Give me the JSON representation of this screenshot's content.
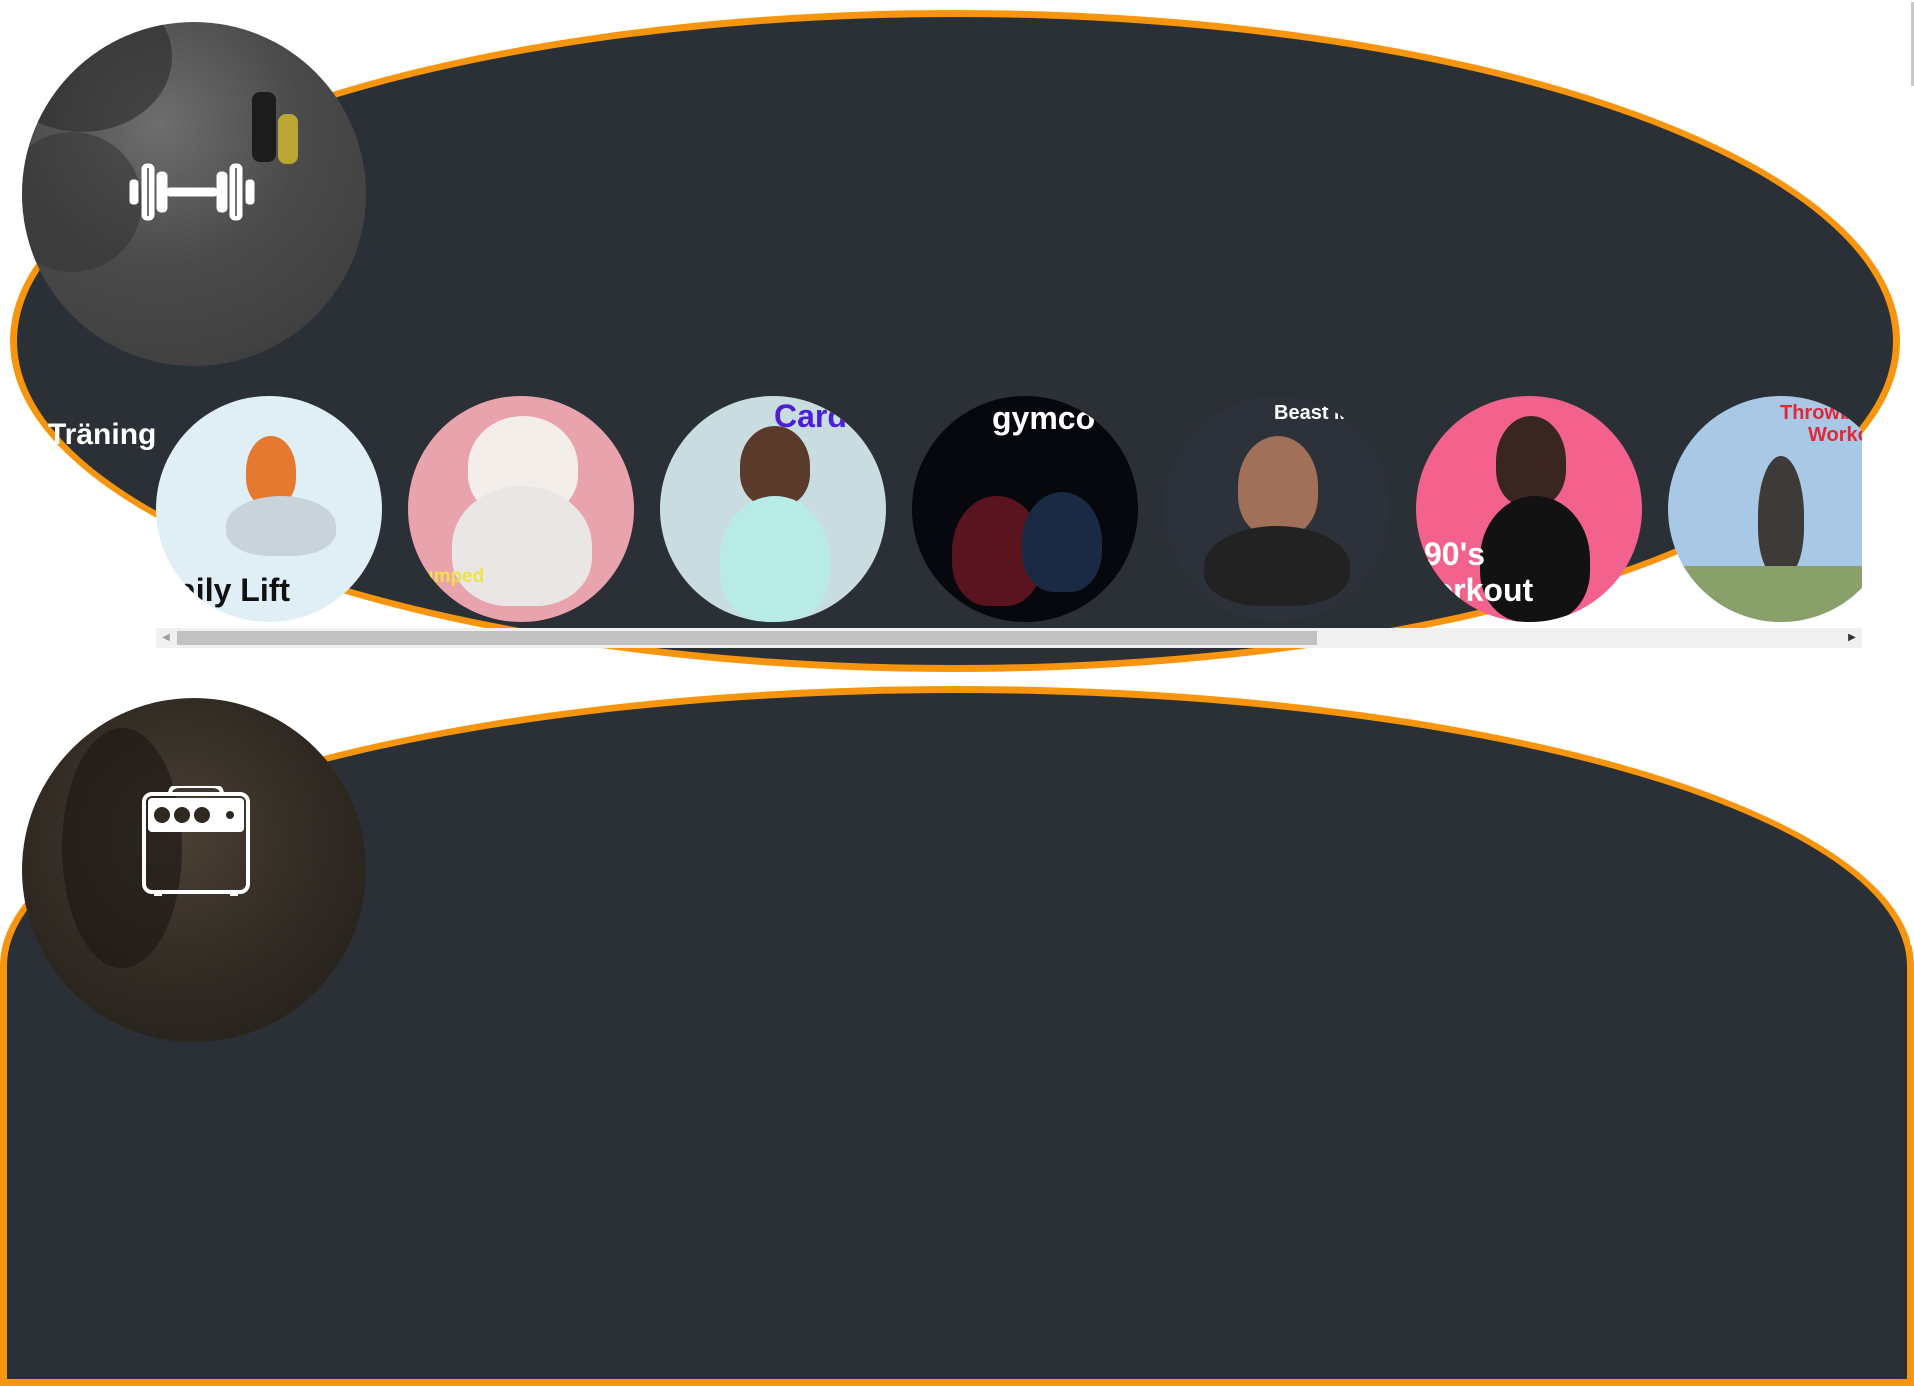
{
  "section_title": "Träning",
  "hero_icons": [
    "dumbbell-icon",
    "amplifier-icon"
  ],
  "cards": [
    {
      "name": "daily-lift",
      "label": "aily Lift",
      "label_color": "#111111",
      "bg": "#dfeff5"
    },
    {
      "name": "pumped",
      "label": "umped",
      "label_color": "#f0e24a",
      "bg": "#e8a3ad"
    },
    {
      "name": "cardio",
      "label": "Card",
      "label_color": "#4b1fd6",
      "bg": "#c9dde1"
    },
    {
      "name": "gymcore",
      "label": "gymco",
      "label_color": "#ffffff",
      "bg": "#07080e"
    },
    {
      "name": "beast-mode",
      "label": "Beast M",
      "label_color": "#ffffff",
      "bg": "#2d313a"
    },
    {
      "name": "90s-workout",
      "label_line1": "90's",
      "label_line2": "Workout",
      "label_color": "#ffffff",
      "bg": "#f2628c"
    },
    {
      "name": "throwback-workout",
      "label_line1": "Throwb",
      "label_line2": "Worko",
      "label_color": "#e0283a",
      "bg": "#a8c8e6"
    }
  ],
  "colors": {
    "accent": "#f7960e",
    "panel": "#2b2f36"
  }
}
